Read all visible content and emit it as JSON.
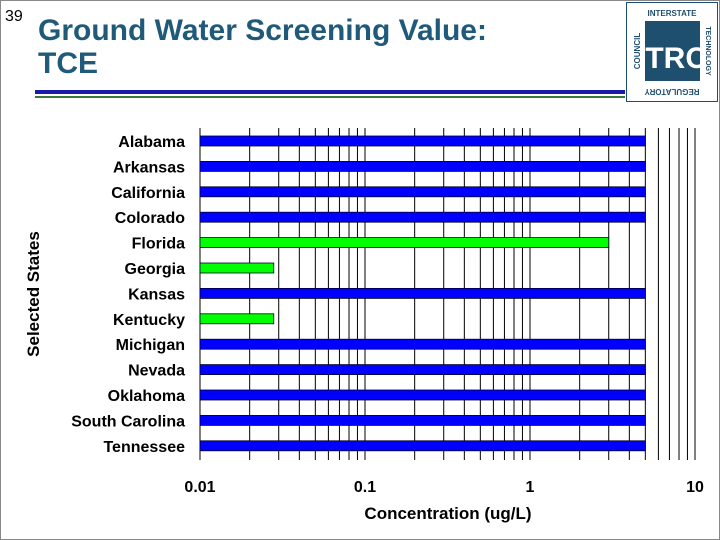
{
  "slide": {
    "number": "39",
    "title_line1": "Ground Water Screening Value:",
    "title_line2": "TCE"
  },
  "logo": {
    "center": "ITRC",
    "top": "INTERSTATE",
    "left": "COUNCIL",
    "right": "TECHNOLOGY",
    "bottom": "REGULATORY",
    "color": "#1f4f6e"
  },
  "chart_data": {
    "type": "bar",
    "orientation": "horizontal",
    "title": "",
    "xlabel": "Concentration (ug/L)",
    "ylabel": "Selected States",
    "x_scale": "log",
    "xlim": [
      0.01,
      10
    ],
    "x_ticks": [
      "0.01",
      "0.1",
      "1",
      "10"
    ],
    "grid": "vertical log gridlines",
    "categories": [
      "Alabama",
      "Arkansas",
      "California",
      "Colorado",
      "Florida",
      "Georgia",
      "Kansas",
      "Kentucky",
      "Michigan",
      "Nevada",
      "Oklahoma",
      "South Carolina",
      "Tennessee"
    ],
    "values": [
      5,
      5,
      5,
      5,
      3,
      0.028,
      5,
      0.028,
      5,
      5,
      5,
      5,
      5
    ],
    "colors": [
      "#0000ff",
      "#0000ff",
      "#0000ff",
      "#0000ff",
      "#00ff00",
      "#00ff00",
      "#0000ff",
      "#00ff00",
      "#0000ff",
      "#0000ff",
      "#0000ff",
      "#0000ff",
      "#0000ff"
    ]
  }
}
